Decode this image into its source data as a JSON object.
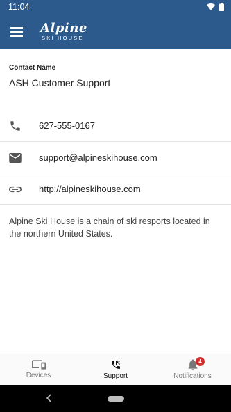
{
  "status_bar": {
    "time": "11:04"
  },
  "app_bar": {
    "logo_main": "Alpine",
    "logo_sub": "SKI HOUSE"
  },
  "contact": {
    "label": "Contact Name",
    "name": "ASH Customer Support",
    "phone": "627-555-0167",
    "email": "support@alpineskihouse.com",
    "website": "http://alpineskihouse.com",
    "description": "Alpine Ski House is a chain of ski resports located in the northern United States."
  },
  "bottom_nav": {
    "items": [
      {
        "label": "Devices"
      },
      {
        "label": "Support"
      },
      {
        "label": "Notifications",
        "badge": "4"
      }
    ],
    "active_index": 1
  },
  "colors": {
    "primary": "#2c5a8c",
    "badge": "#d32f2f"
  }
}
